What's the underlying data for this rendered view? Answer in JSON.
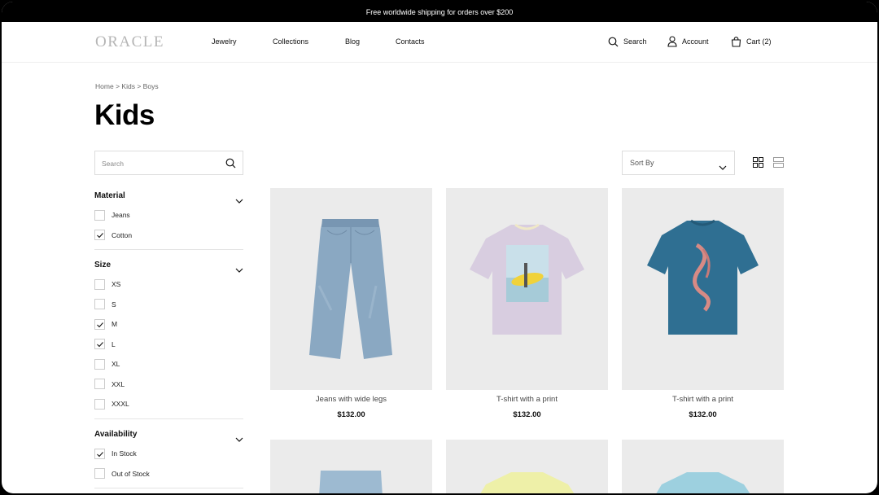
{
  "promo": "Free worldwide shipping for orders over $200",
  "header": {
    "logo": "ORACLE",
    "nav": [
      "Jewelry",
      "Collections",
      "Blog",
      "Contacts"
    ],
    "search_label": "Search",
    "account_label": "Account",
    "cart_label": "Cart (2)"
  },
  "breadcrumb": [
    "Home",
    "Kids",
    "Boys"
  ],
  "breadcrumb_sep": ">",
  "page_title": "Kids",
  "sidebar_search": {
    "placeholder": "Search"
  },
  "filters": {
    "material": {
      "title": "Material",
      "options": [
        {
          "label": "Jeans",
          "checked": false
        },
        {
          "label": "Cotton",
          "checked": true
        }
      ]
    },
    "size": {
      "title": "Size",
      "options": [
        {
          "label": "XS",
          "checked": false
        },
        {
          "label": "S",
          "checked": false
        },
        {
          "label": "M",
          "checked": true
        },
        {
          "label": "L",
          "checked": true
        },
        {
          "label": "XL",
          "checked": false
        },
        {
          "label": "XXL",
          "checked": false
        },
        {
          "label": "XXXL",
          "checked": false
        }
      ]
    },
    "availability": {
      "title": "Availability",
      "options": [
        {
          "label": "In Stock",
          "checked": true
        },
        {
          "label": "Out of Stock",
          "checked": false
        }
      ]
    }
  },
  "sort": {
    "label": "Sort By"
  },
  "products": [
    {
      "name": "Jeans with wide legs",
      "price": "$132.00"
    },
    {
      "name": "T-shirt with a print",
      "price": "$132.00"
    },
    {
      "name": "T-shirt with a print",
      "price": "$132.00"
    }
  ],
  "colors": {
    "promo_bg": "#000000",
    "card_bg": "#ebebeb",
    "logo": "#b5b5b5",
    "denim": "#8aa8c2",
    "lavender_tee": "#d8cde0",
    "blue_tee": "#2f6f92",
    "yellow_tee": "#eef0a8",
    "light_blue_tee": "#9dd0df"
  }
}
